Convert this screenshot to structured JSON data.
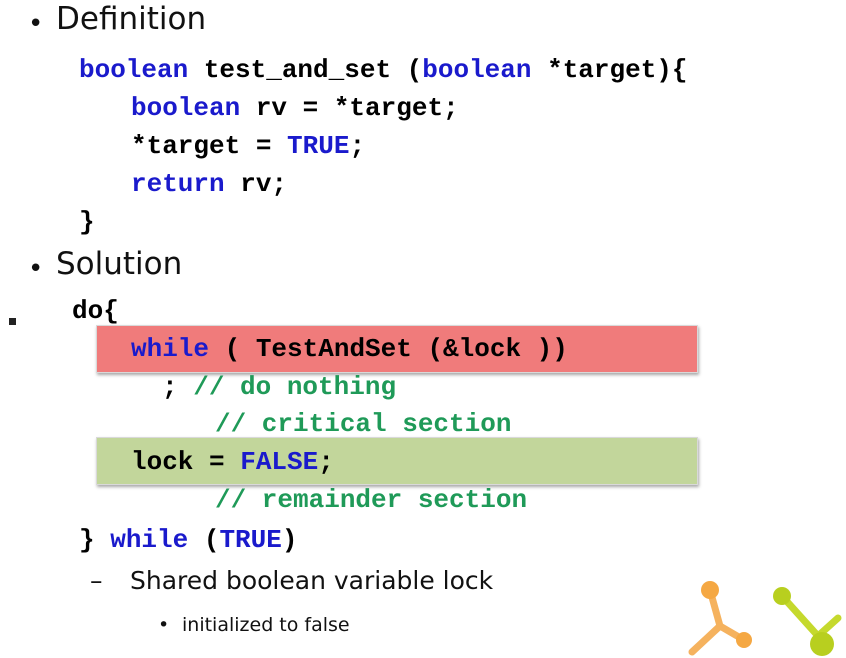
{
  "bullets": {
    "bullet_glyph": "•",
    "definition_label": "Definition",
    "solution_label": "Solution"
  },
  "definition_code": {
    "line1_kw": "boolean",
    "line1_rest": " test_and_set (",
    "line1_kw2": "boolean",
    "line1_end": " *target){",
    "line2_kw": "boolean",
    "line2_rest": " rv = *target;",
    "line3_start": "*target = ",
    "line3_kw": "TRUE",
    "line3_end": ";",
    "line4_kw": "return",
    "line4_rest": " rv;",
    "line5": "}"
  },
  "solution_code": {
    "do_line": "do{",
    "while_kw": "while",
    "while_rest": " ( TestAndSet (&lock ))",
    "semicolon": ";",
    "comment_nothing": "// do nothing",
    "comment_critical": "// critical section",
    "lock_start": "lock = ",
    "lock_kw": "FALSE",
    "lock_end": ";",
    "comment_remainder": "// remainder section",
    "end_start": "} ",
    "end_while_kw": "while",
    "end_paren_open": " (",
    "end_true_kw": "TRUE",
    "end_paren_close": ")"
  },
  "notes": {
    "dash": "–",
    "shared_text": "Shared boolean variable lock",
    "sub_bullet": "•",
    "initialized_text": "initialized to false"
  },
  "colors": {
    "keyword": "#1a1acc",
    "comment": "#1f9a58",
    "highlight_red": "#f07b7b",
    "highlight_green": "#c2d69b"
  },
  "decoration": {
    "logo_icon": "molecule-logo-icon",
    "marker_icon": "square-marker-icon"
  }
}
